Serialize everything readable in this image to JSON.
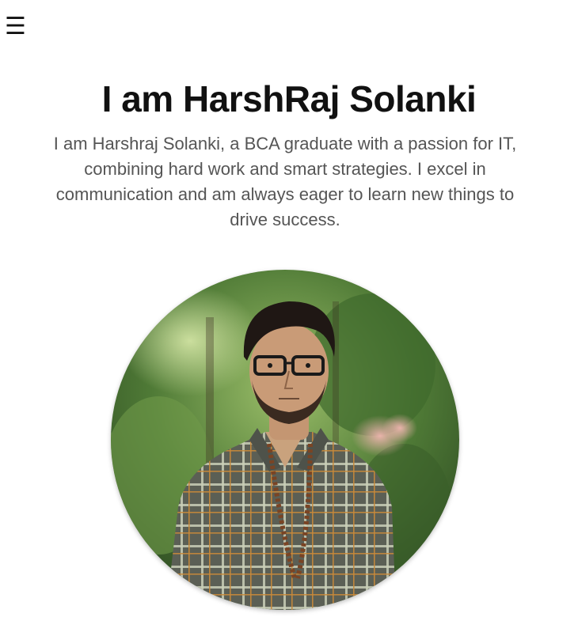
{
  "nav": {
    "menu_icon": "hamburger-menu-icon",
    "menu_glyph": "☰"
  },
  "hero": {
    "title": "I am HarshRaj Solanki",
    "intro": "I am Harshraj Solanki, a BCA graduate with a passion for IT, combining hard work and smart strategies. I excel in communication and am always eager to learn new things to drive success."
  },
  "portrait": {
    "alt": "Portrait photo of HarshRaj Solanki"
  },
  "colors": {
    "title": "#111111",
    "body_text": "#555555",
    "background": "#ffffff"
  }
}
